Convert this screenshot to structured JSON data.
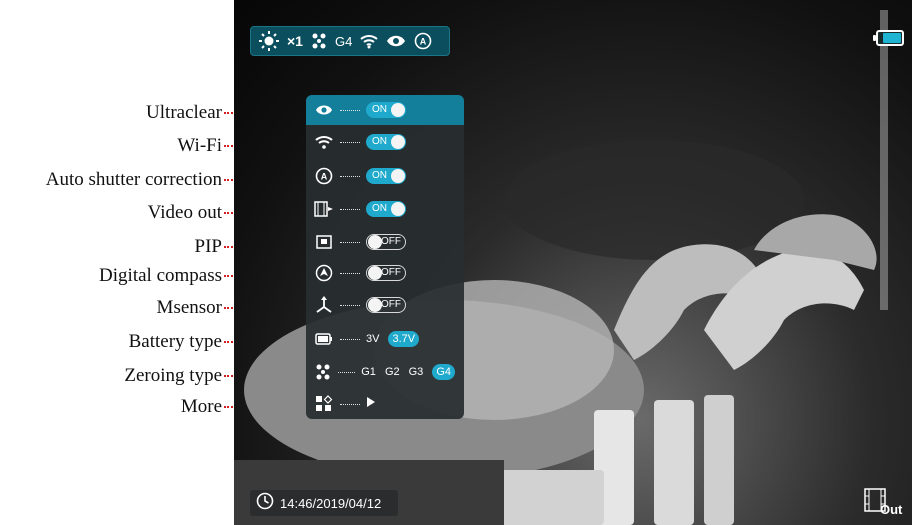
{
  "callouts": [
    {
      "label": "Ultraclear"
    },
    {
      "label": "Wi-Fi"
    },
    {
      "label": "Auto shutter correction"
    },
    {
      "label": "Video out"
    },
    {
      "label": "PIP"
    },
    {
      "label": "Digital compass"
    },
    {
      "label": "Msensor"
    },
    {
      "label": "Battery type"
    },
    {
      "label": "Zeroing type"
    },
    {
      "label": "More"
    }
  ],
  "status_bar": {
    "zoom": "×1",
    "zeroing": "G4",
    "icons": [
      "brightness-icon",
      "zeroing-icon",
      "wifi-icon",
      "ultraclear-eye-icon",
      "auto-shutter-icon"
    ]
  },
  "battery": {
    "level": 0.75,
    "color": "#1fb4d2"
  },
  "menu": {
    "items": [
      {
        "icon": "eye-icon",
        "control": "toggle",
        "state": "ON",
        "selected": true
      },
      {
        "icon": "wifi-icon",
        "control": "toggle",
        "state": "ON"
      },
      {
        "icon": "auto-shutter-icon",
        "control": "toggle",
        "state": "ON"
      },
      {
        "icon": "video-out-icon",
        "control": "toggle",
        "state": "ON"
      },
      {
        "icon": "pip-icon",
        "control": "toggle",
        "state": "OFF"
      },
      {
        "icon": "compass-icon",
        "control": "toggle",
        "state": "OFF"
      },
      {
        "icon": "msensor-icon",
        "control": "toggle",
        "state": "OFF"
      },
      {
        "icon": "battery-icon",
        "control": "options",
        "options": [
          "3V",
          "3.7V"
        ],
        "selected_option": "3.7V"
      },
      {
        "icon": "zeroing-icon",
        "control": "options",
        "options": [
          "G1",
          "G2",
          "G3",
          "G4"
        ],
        "selected_option": "G4"
      },
      {
        "icon": "more-icon",
        "control": "arrow"
      }
    ]
  },
  "time": {
    "text": "14:46/2019/04/12"
  },
  "video_out": {
    "label": "Out"
  },
  "colors": {
    "accent": "#1fa9cc",
    "menu_selected": "#137f9b",
    "status_bg": "#0b4f5e",
    "leader": "#d42020"
  }
}
